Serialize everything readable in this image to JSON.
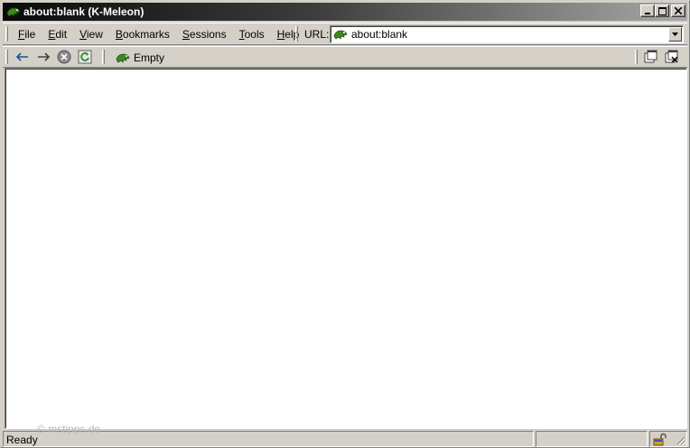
{
  "window": {
    "title": "about:blank (K-Meleon)"
  },
  "menu": [
    {
      "label": "File",
      "key": "F",
      "rest": "ile"
    },
    {
      "label": "Edit",
      "key": "E",
      "rest": "dit"
    },
    {
      "label": "View",
      "key": "V",
      "rest": "iew"
    },
    {
      "label": "Bookmarks",
      "key": "B",
      "rest": "ookmarks"
    },
    {
      "label": "Sessions",
      "key": "S",
      "rest": "essions"
    },
    {
      "label": "Tools",
      "key": "T",
      "rest": "ools"
    },
    {
      "label": "Help",
      "key": "H",
      "rest": "elp"
    }
  ],
  "urlbar": {
    "label": "URL:",
    "value": "about:blank"
  },
  "bookmarks": {
    "label": "Empty"
  },
  "status": {
    "text": "Ready"
  },
  "watermark": "© mstipps.de",
  "colors": {
    "accent_green": "#3a8a1e",
    "titlebar_dark": "#0a0a0a",
    "chrome": "#d4d0c8"
  }
}
